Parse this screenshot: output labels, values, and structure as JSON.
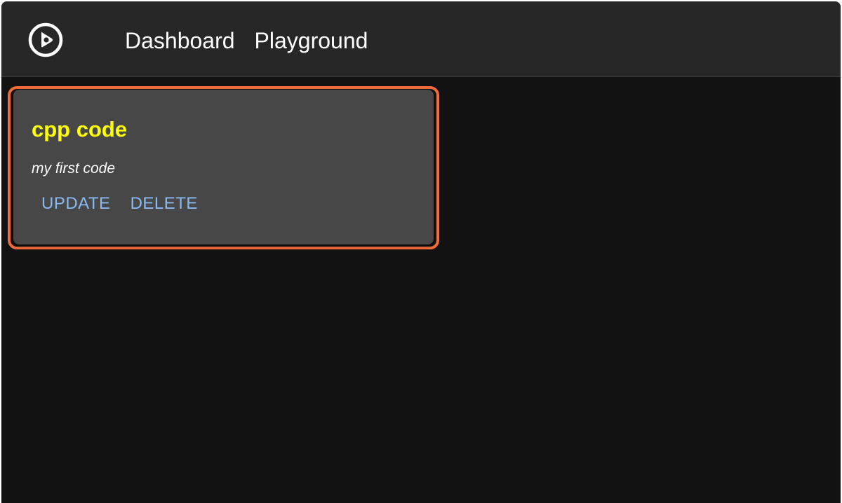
{
  "header": {
    "logo_icon": "play-circle-icon",
    "nav": [
      {
        "label": "Dashboard"
      },
      {
        "label": "Playground"
      }
    ]
  },
  "card": {
    "title": "cpp code",
    "description": "my first code",
    "actions": {
      "update_label": "UPDATE",
      "delete_label": "DELETE"
    }
  },
  "colors": {
    "background": "#121212",
    "appbar": "#272727",
    "card": "#474747",
    "title": "#ffff00",
    "action": "#8ab9f1",
    "highlight": "#f26b3a"
  }
}
